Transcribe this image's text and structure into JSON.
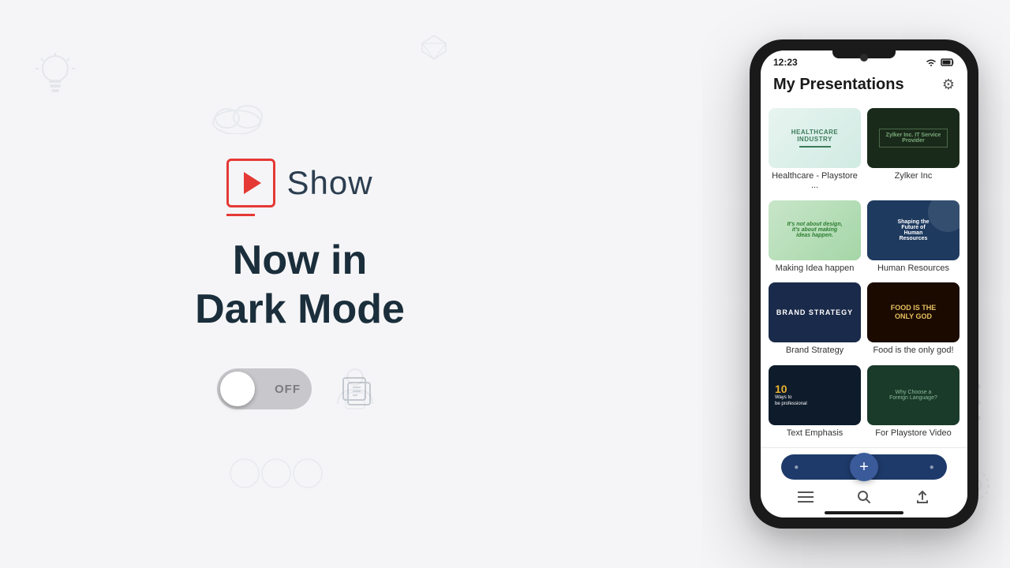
{
  "app": {
    "name": "Show",
    "tagline_line1": "Now in",
    "tagline_line2": "Dark Mode",
    "toggle_label": "OFF",
    "status_time": "12:23"
  },
  "header": {
    "title": "My Presentations",
    "settings_icon": "⚙"
  },
  "presentations": [
    {
      "id": 1,
      "name": "Healthcare - Playstore ...",
      "theme": "healthcare"
    },
    {
      "id": 2,
      "name": "Zylker Inc",
      "theme": "zylker"
    },
    {
      "id": 3,
      "name": "Making Idea happen",
      "theme": "idea"
    },
    {
      "id": 4,
      "name": "Human Resources",
      "theme": "hr"
    },
    {
      "id": 5,
      "name": "Brand Strategy",
      "theme": "brand"
    },
    {
      "id": 6,
      "name": "Food is the only god!",
      "theme": "food"
    },
    {
      "id": 7,
      "name": "Text Emphasis",
      "theme": "text-emph"
    },
    {
      "id": 8,
      "name": "For Playstore Video",
      "theme": "playstore"
    }
  ],
  "nav": {
    "menu_icon": "☰",
    "search_icon": "🔍",
    "upload_icon": "⬆"
  },
  "thumb_content": {
    "healthcare_title": "HEALTHCARE INDUSTRY",
    "zylker_line1": "Zylker Inc. IT Service",
    "zylker_line2": "Provider",
    "idea_text": "It's not about design,\nit's about making ideas happen.",
    "hr_text": "Shaping the\nFuture of\nHuman\nResources",
    "brand_text": "BRAND STRATEGY",
    "food_text": "FOOD IS THE\nONLY GOD",
    "te_num": "10",
    "te_label": "Ways to\nbe professional",
    "ps_text": "Why Choose a\nForeign Language?"
  }
}
